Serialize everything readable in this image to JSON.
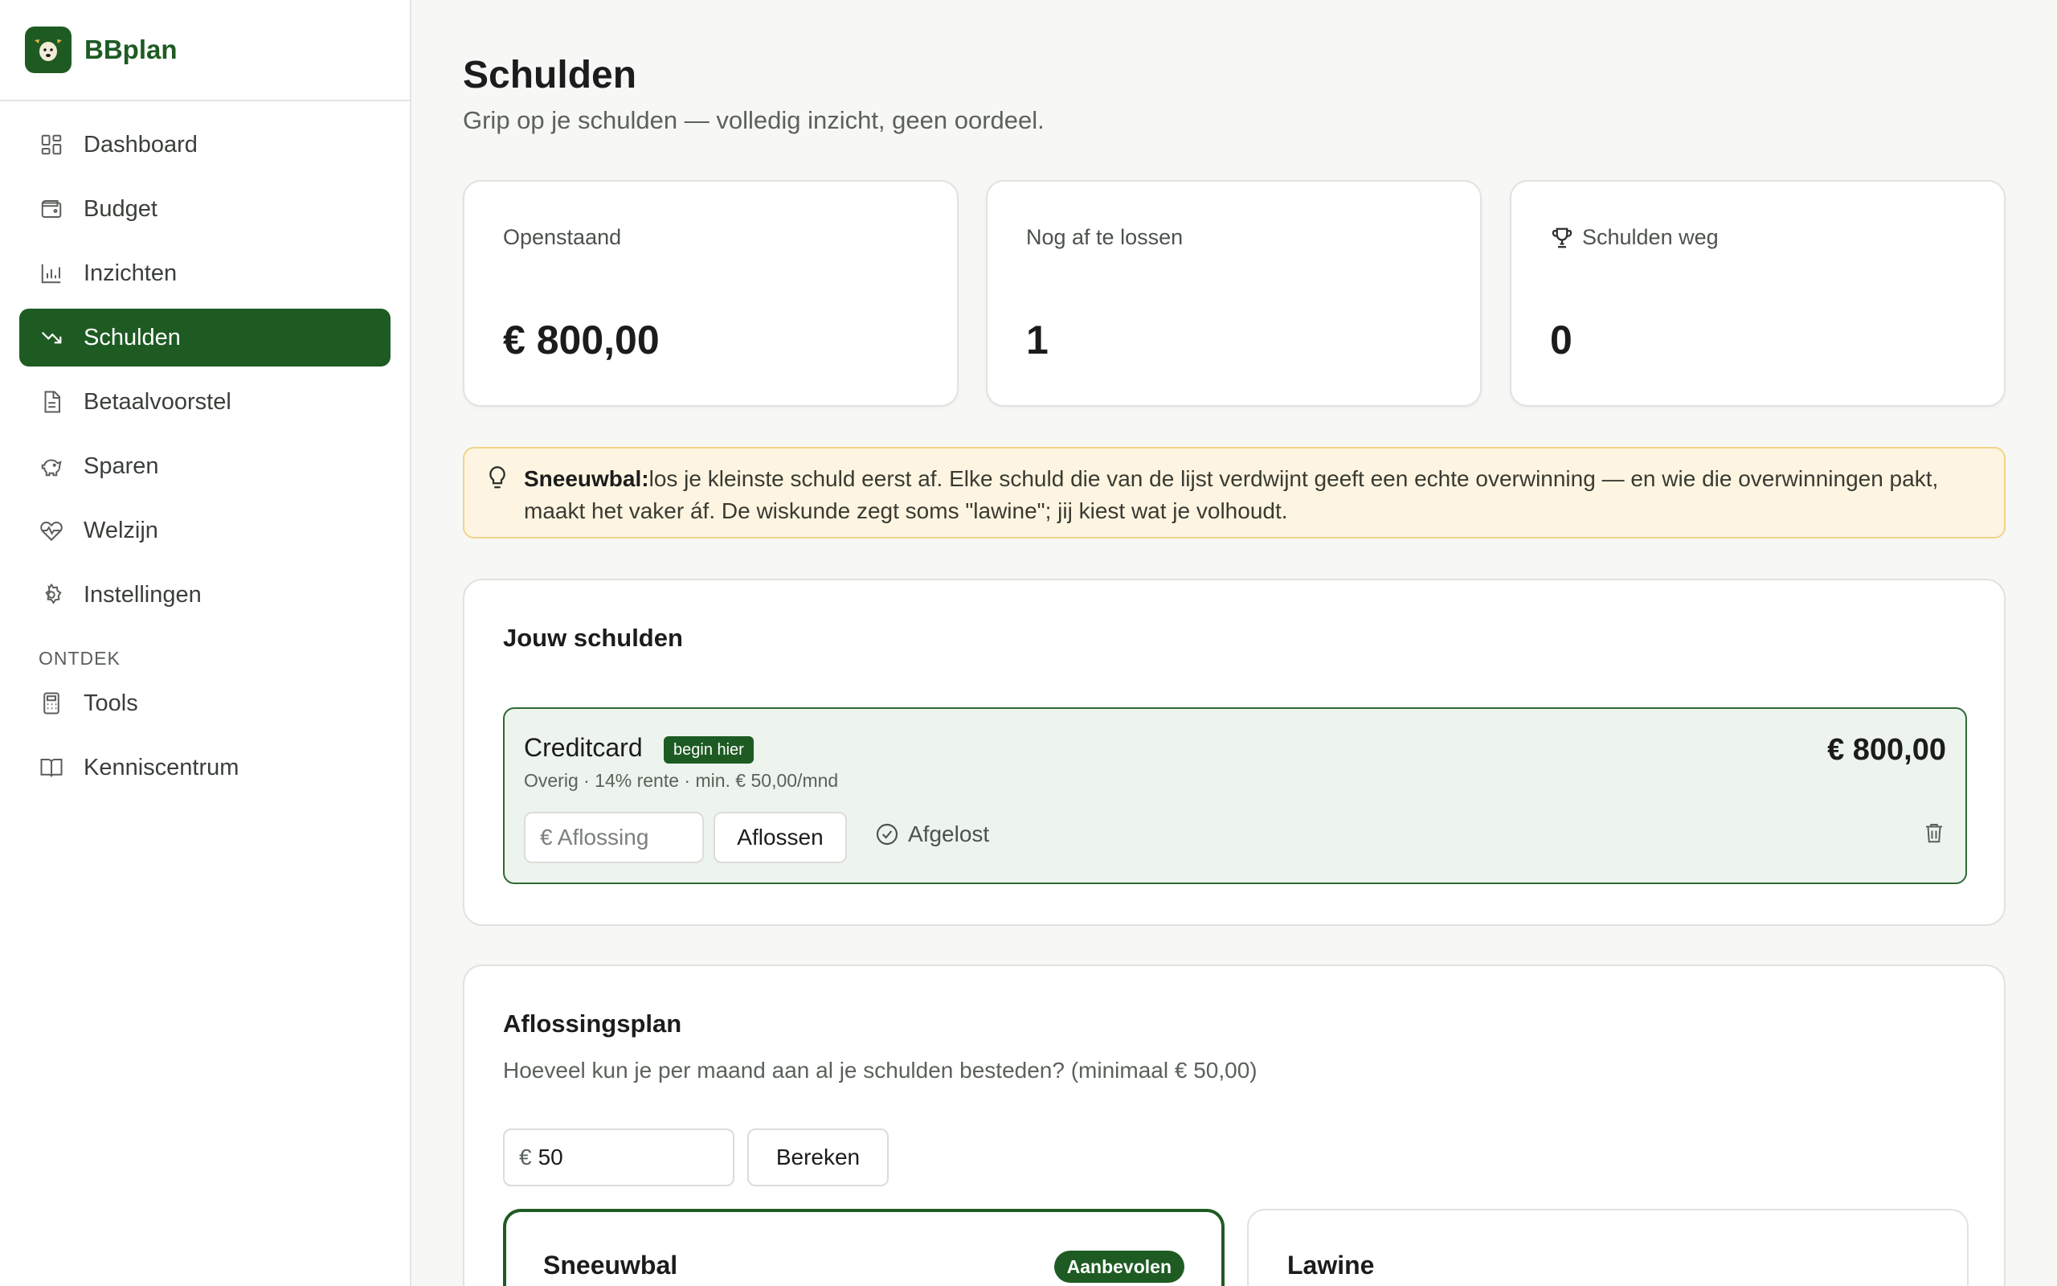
{
  "app": {
    "name": "BBplan",
    "logo_icon": "sheep-icon",
    "accent": "#1e5b23"
  },
  "sidebar": {
    "items": [
      {
        "label": "Dashboard",
        "icon": "dashboard-icon"
      },
      {
        "label": "Budget",
        "icon": "wallet-icon"
      },
      {
        "label": "Inzichten",
        "icon": "bar-chart-icon"
      },
      {
        "label": "Schulden",
        "icon": "trending-down-icon",
        "active": true
      },
      {
        "label": "Betaalvoorstel",
        "icon": "document-icon"
      },
      {
        "label": "Sparen",
        "icon": "piggy-bank-icon"
      },
      {
        "label": "Welzijn",
        "icon": "heart-pulse-icon"
      },
      {
        "label": "Instellingen",
        "icon": "gear-icon"
      }
    ],
    "section_label": "ONTDEK",
    "section_items": [
      {
        "label": "Tools",
        "icon": "calculator-icon"
      },
      {
        "label": "Kenniscentrum",
        "icon": "book-icon"
      }
    ]
  },
  "page": {
    "title": "Schulden",
    "subtitle": "Grip op je schulden — volledig inzicht, geen oordeel."
  },
  "stats": [
    {
      "label": "Openstaand",
      "value": "€ 800,00"
    },
    {
      "label": "Nog af te lossen",
      "value": "1"
    },
    {
      "label": "Schulden weg",
      "value": "0",
      "icon": "trophy-icon"
    }
  ],
  "tip": {
    "icon": "lightbulb-icon",
    "bold": "Sneeuwbal:",
    "text": "los je kleinste schuld eerst af. Elke schuld die van de lijst verdwijnt geeft een echte overwinning — en wie die overwinningen pakt, maakt het vaker áf. De wiskunde zegt soms \"lawine\"; jij kiest wat je volhoudt."
  },
  "debts_card": {
    "title": "Jouw schulden",
    "debts": [
      {
        "name": "Creditcard",
        "badge": "begin hier",
        "meta": "Overig · 14% rente · min. € 50,00/mnd",
        "amount": "€ 800,00",
        "payment_placeholder": "€ Aflossing",
        "pay_button": "Aflossen",
        "paid_label": "Afgelost"
      }
    ]
  },
  "plan_card": {
    "title": "Aflossingsplan",
    "description": "Hoeveel kun je per maand aan al je schulden besteden? (minimaal € 50,00)",
    "currency_prefix": "€",
    "amount_value": "50",
    "calc_button": "Bereken",
    "strategies": [
      {
        "title": "Sneeuwbal",
        "badge": "Aanbevolen"
      },
      {
        "title": "Lawine"
      }
    ]
  }
}
